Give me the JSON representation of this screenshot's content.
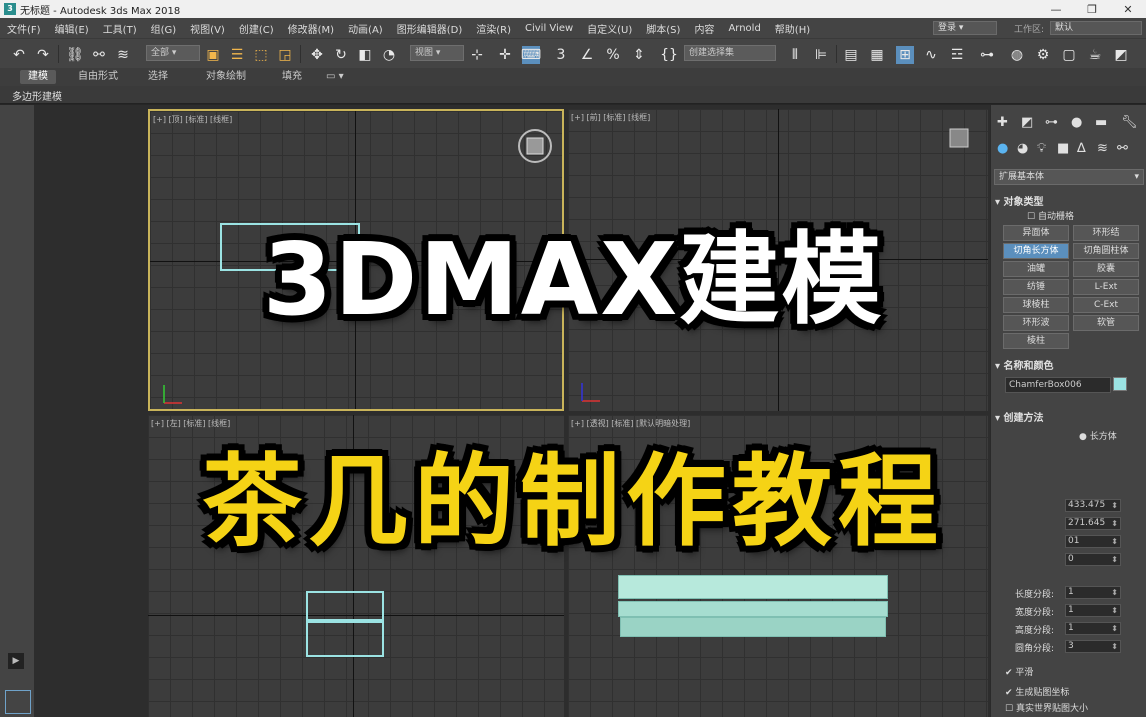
{
  "window": {
    "app_icon": "3ds Max",
    "title": "无标题 - Autodesk 3ds Max 2018",
    "minimize": "—",
    "maximize": "❐",
    "close": "✕"
  },
  "menu": [
    "文件(F)",
    "编辑(E)",
    "工具(T)",
    "组(G)",
    "视图(V)",
    "创建(C)",
    "修改器(M)",
    "动画(A)",
    "图形编辑器(D)",
    "渲染(R)",
    "Civil View",
    "自定义(U)",
    "脚本(S)",
    "内容",
    "Arnold",
    "帮助(H)"
  ],
  "account": {
    "user": "登录",
    "workspace_label": "工作区:",
    "workspace_value": "默认"
  },
  "toolbar": {
    "selection_filter": "全部",
    "ref_coord": "视图",
    "named_selection": "创建选择集",
    "icons": [
      "undo-icon",
      "redo-icon",
      "link-icon",
      "unlink-icon",
      "bind-space-warp-icon",
      "select-object-icon",
      "select-by-name-icon",
      "rect-select-icon",
      "window-crossing-icon",
      "move-icon",
      "rotate-icon",
      "scale-icon",
      "pivot-icon",
      "select-manipulate-icon",
      "keyboard-shortcut-icon",
      "snap-icon",
      "angle-snap-icon",
      "percent-snap-icon",
      "spinner-snap-icon",
      "edit-named-sel-icon",
      "mirror-icon",
      "align-icon",
      "layer-explorer-icon",
      "scene-explorer-icon",
      "curve-editor-icon",
      "schematic-view-icon",
      "material-editor-icon",
      "render-setup-icon",
      "render-frame-icon",
      "render-icon"
    ]
  },
  "ribbon": {
    "tabs": [
      "建模",
      "自由形式",
      "选择",
      "对象绘制",
      "填充"
    ],
    "active": "建模",
    "panel_label": "多边形建模"
  },
  "viewports": {
    "top_left": "[+] [顶] [标准] [线框]",
    "top_right": "[+] [前] [标准] [线框]",
    "bottom_left": "[+] [左] [标准] [线框]",
    "bottom_right": "[+] [透视] [标准] [默认明暗处理]"
  },
  "command_panel": {
    "category": "扩展基本体",
    "object_type_title": "对象类型",
    "auto_grid": "自动栅格",
    "objects": [
      "异面体",
      "环形结",
      "切角长方体",
      "切角圆柱体",
      "油罐",
      "胶囊",
      "纺锤",
      "L-Ext",
      "球棱柱",
      "C-Ext",
      "环形波",
      "软管",
      "棱柱"
    ],
    "active_object": "切角长方体",
    "name_color_title": "名称和颜色",
    "object_name": "ChamferBox006",
    "creation_method_title": "创建方法",
    "creation_method_value": "长方体",
    "values": [
      "433.475",
      "271.645",
      "01",
      "0"
    ],
    "params": [
      {
        "label": "长度分段:",
        "value": "1"
      },
      {
        "label": "宽度分段:",
        "value": "1"
      },
      {
        "label": "高度分段:",
        "value": "1"
      },
      {
        "label": "圆角分段:",
        "value": "3"
      }
    ],
    "smooth": "平滑",
    "gen_mapping": "生成贴图坐标",
    "real_world": "真实世界贴图大小"
  },
  "overlay": {
    "line1": "3DMAX建模",
    "line2": "茶几的制作教程"
  },
  "colors": {
    "overlay_white": "#ffffff",
    "overlay_yellow": "#f5d315",
    "object_mint": "#9be3e3",
    "active_viewport": "#c9b45a"
  }
}
